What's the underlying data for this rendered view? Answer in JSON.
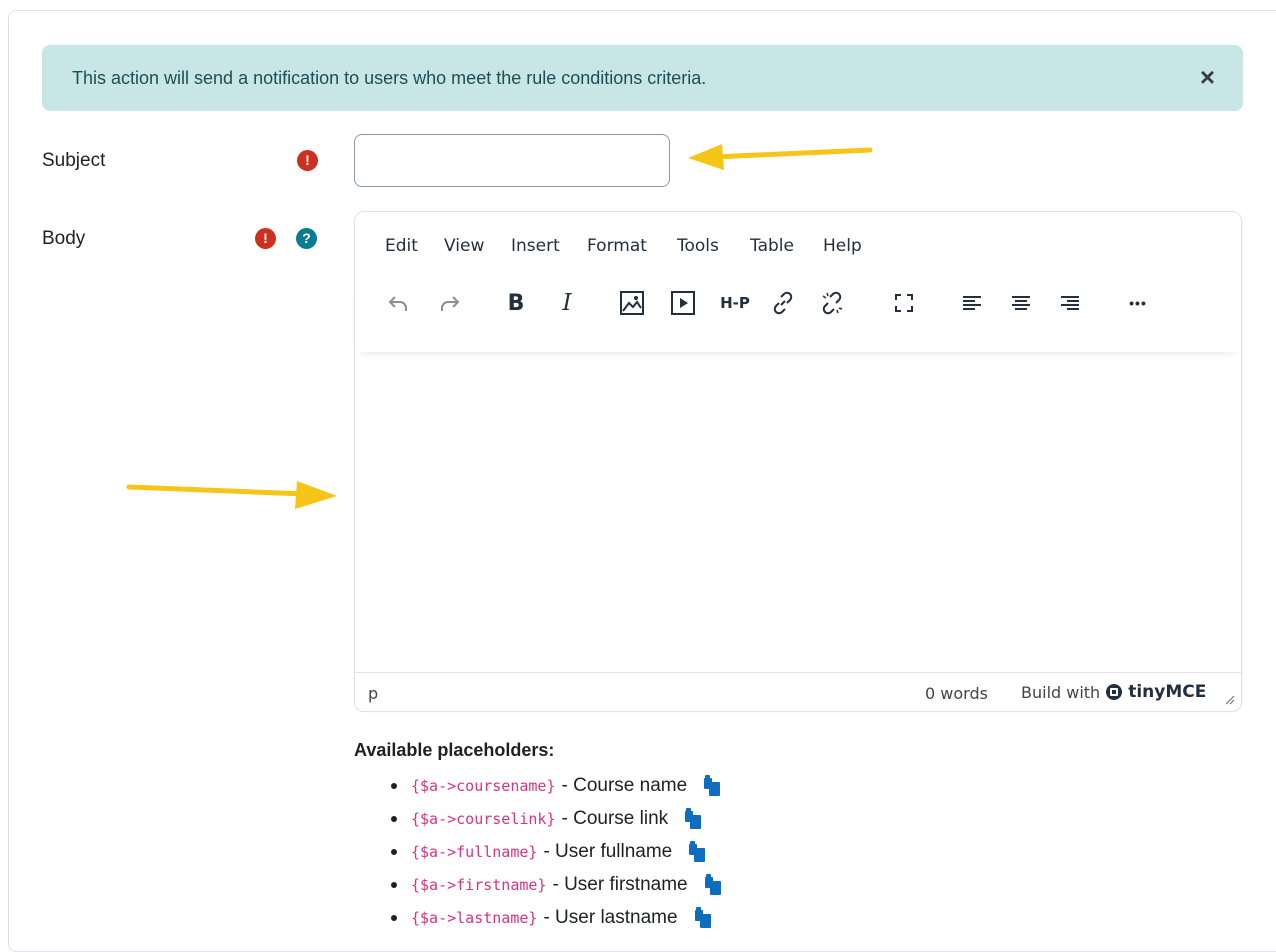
{
  "alert": {
    "message": "This action will send a notification to users who meet the rule conditions criteria.",
    "close_symbol": "×"
  },
  "form": {
    "subject": {
      "label": "Subject",
      "required_badge": "!",
      "value": ""
    },
    "body": {
      "label": "Body",
      "required_badge": "!",
      "help_badge": "?"
    }
  },
  "editor": {
    "menu": [
      "Edit",
      "View",
      "Insert",
      "Format",
      "Tools",
      "Table",
      "Help"
    ],
    "toolbar_icons": [
      "undo-icon",
      "redo-icon",
      "bold-icon",
      "italic-icon",
      "image-icon",
      "media-icon",
      "h5p-icon",
      "link-icon",
      "unlink-icon",
      "fullscreen-icon",
      "align-left-icon",
      "align-center-icon",
      "align-right-icon",
      "more-icon"
    ],
    "toolbar_text": {
      "bold": "B",
      "italic": "I",
      "h5p": "H-P",
      "more": "•••"
    },
    "status": {
      "path": "p",
      "word_count": "0 words",
      "brand_prefix": "Build with",
      "brand_name": "tinyMCE"
    }
  },
  "placeholders": {
    "title": "Available placeholders:",
    "items": [
      {
        "code": "{$a->coursename}",
        "desc": "- Course name"
      },
      {
        "code": "{$a->courselink}",
        "desc": "- Course link"
      },
      {
        "code": "{$a->fullname}",
        "desc": "- User fullname"
      },
      {
        "code": "{$a->firstname}",
        "desc": "- User firstname"
      },
      {
        "code": "{$a->lastname}",
        "desc": "- User lastname"
      }
    ]
  },
  "colors": {
    "alert_bg": "#c7e6e5",
    "required_badge": "#ca3120",
    "help_badge": "#0a7b93",
    "placeholder_code": "#d63384",
    "copy_icon": "#0f6cbf",
    "annotation_arrow": "#f5c518"
  }
}
